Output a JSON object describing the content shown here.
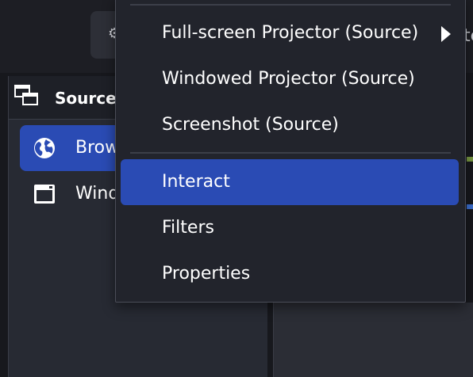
{
  "top_bar": {
    "button_icon": "settings-gear-icon",
    "right_fragment": "te"
  },
  "sources": {
    "title": "Sources",
    "header_icon": "sources-windows-icon",
    "items": [
      {
        "label": "Brow",
        "icon": "globe-icon",
        "selected": true
      },
      {
        "label": "Wind",
        "icon": "window-capture-icon",
        "selected": false
      }
    ]
  },
  "context_menu": {
    "items": [
      {
        "label": "Full-screen Projector (Source)",
        "has_submenu": true,
        "highlighted": false
      },
      {
        "label": "Windowed Projector (Source)",
        "has_submenu": false,
        "highlighted": false
      },
      {
        "label": "Screenshot (Source)",
        "has_submenu": false,
        "highlighted": false
      },
      {
        "label": "Interact",
        "has_submenu": false,
        "highlighted": true
      },
      {
        "label": "Filters",
        "has_submenu": false,
        "highlighted": false
      },
      {
        "label": "Properties",
        "has_submenu": false,
        "highlighted": false
      }
    ]
  },
  "colors": {
    "accent": "#2a4bb4",
    "menu_background": "#22242c",
    "panel_background": "#272a33",
    "text": "#ffffff"
  }
}
